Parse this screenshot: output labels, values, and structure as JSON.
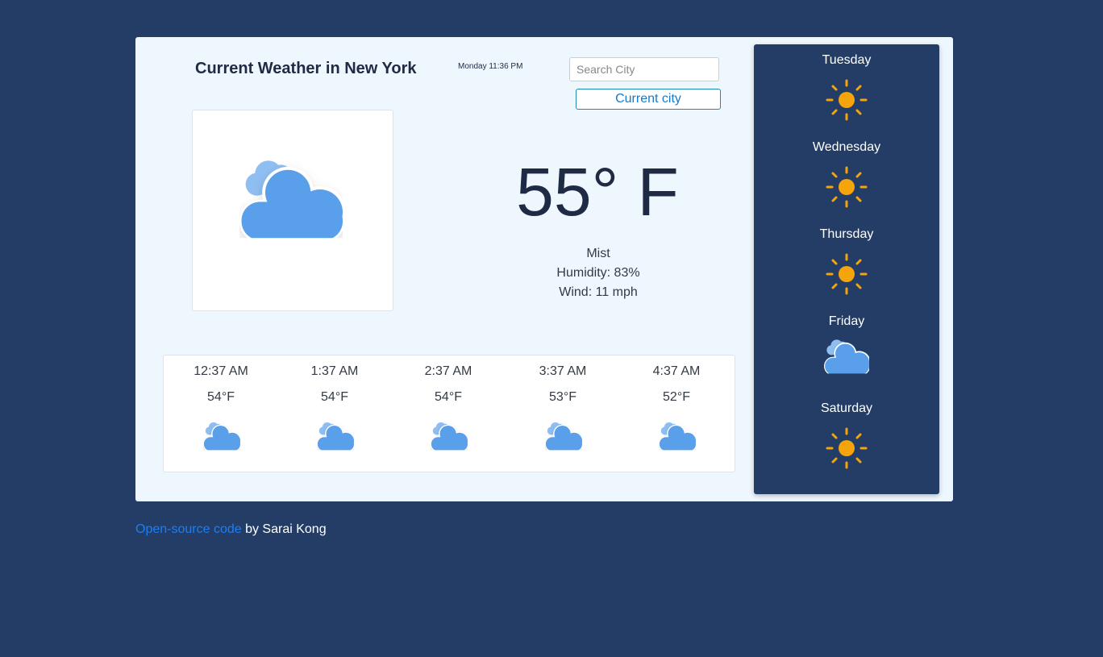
{
  "header": {
    "title": "Current Weather in New York",
    "datetime": "Monday 11:36 PM"
  },
  "search": {
    "placeholder": "Search City",
    "current_city_label": "Current city"
  },
  "current": {
    "icon": "partly-cloudy-icon",
    "temperature": "55° F",
    "description": "Mist",
    "humidity": "Humidity: 83%",
    "wind": "Wind: 11 mph"
  },
  "hourly": [
    {
      "time": "12:37 AM",
      "temp": "54°F",
      "icon": "partly-cloudy-icon"
    },
    {
      "time": "1:37 AM",
      "temp": "54°F",
      "icon": "partly-cloudy-icon"
    },
    {
      "time": "2:37 AM",
      "temp": "54°F",
      "icon": "partly-cloudy-icon"
    },
    {
      "time": "3:37 AM",
      "temp": "53°F",
      "icon": "partly-cloudy-icon"
    },
    {
      "time": "4:37 AM",
      "temp": "52°F",
      "icon": "partly-cloudy-icon"
    }
  ],
  "forecast": [
    {
      "day": "Tuesday",
      "icon": "sun-icon"
    },
    {
      "day": "Wednesday",
      "icon": "sun-icon"
    },
    {
      "day": "Thursday",
      "icon": "sun-icon"
    },
    {
      "day": "Friday",
      "icon": "partly-cloudy-icon"
    },
    {
      "day": "Saturday",
      "icon": "sun-icon"
    }
  ],
  "footer": {
    "link_text": "Open-source code",
    "text": " by Sarai Kong"
  },
  "colors": {
    "page_background": "#233d66",
    "card_background": "#eef6fe",
    "cloud": "#5a9fea",
    "cloud_light": "#8fbef2",
    "sun": "#f5a40c",
    "link": "#1e7ef0"
  }
}
